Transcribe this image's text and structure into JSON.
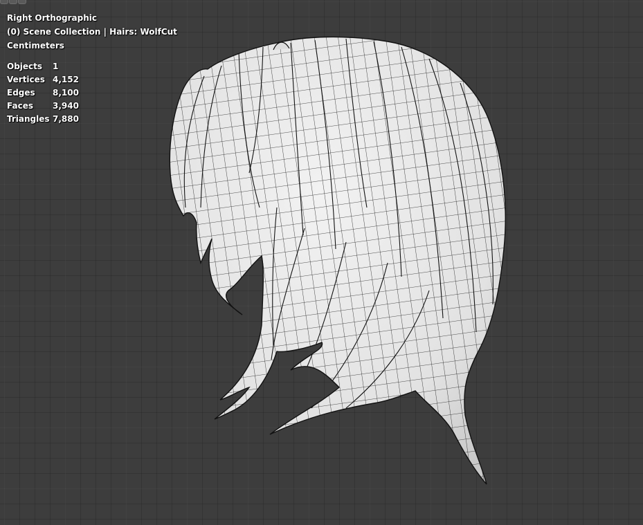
{
  "viewport": {
    "view_name": "Right Orthographic",
    "collection_line": "(0) Scene Collection | Hairs: WolfCut",
    "units": "Centimeters"
  },
  "statistics": [
    {
      "label": "Objects",
      "value": "1"
    },
    {
      "label": "Vertices",
      "value": "4,152"
    },
    {
      "label": "Edges",
      "value": "8,100"
    },
    {
      "label": "Faces",
      "value": "3,940"
    },
    {
      "label": "Triangles",
      "value": "7,880"
    }
  ],
  "colors": {
    "background": "#3d3d3d",
    "mesh_fill": "#e6e6e6",
    "mesh_wire": "#1a1a1a"
  }
}
